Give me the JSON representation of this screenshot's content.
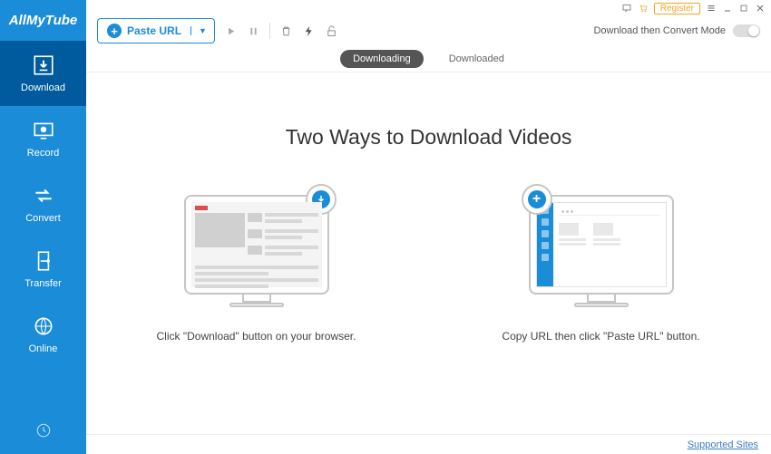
{
  "app": {
    "logo": "AllMyTube"
  },
  "sidebar": {
    "items": [
      {
        "label": "Download"
      },
      {
        "label": "Record"
      },
      {
        "label": "Convert"
      },
      {
        "label": "Transfer"
      },
      {
        "label": "Online"
      }
    ]
  },
  "titlebar": {
    "register": "Register"
  },
  "toolbar": {
    "paste_label": "Paste URL",
    "convert_mode_label": "Download then Convert Mode"
  },
  "tabs": {
    "downloading": "Downloading",
    "downloaded": "Downloaded"
  },
  "content": {
    "title": "Two Ways to Download Videos",
    "caption_left": "Click \"Download\" button on your browser.",
    "caption_right": "Copy URL then click \"Paste URL\" button."
  },
  "footer": {
    "supported_sites": "Supported Sites"
  }
}
